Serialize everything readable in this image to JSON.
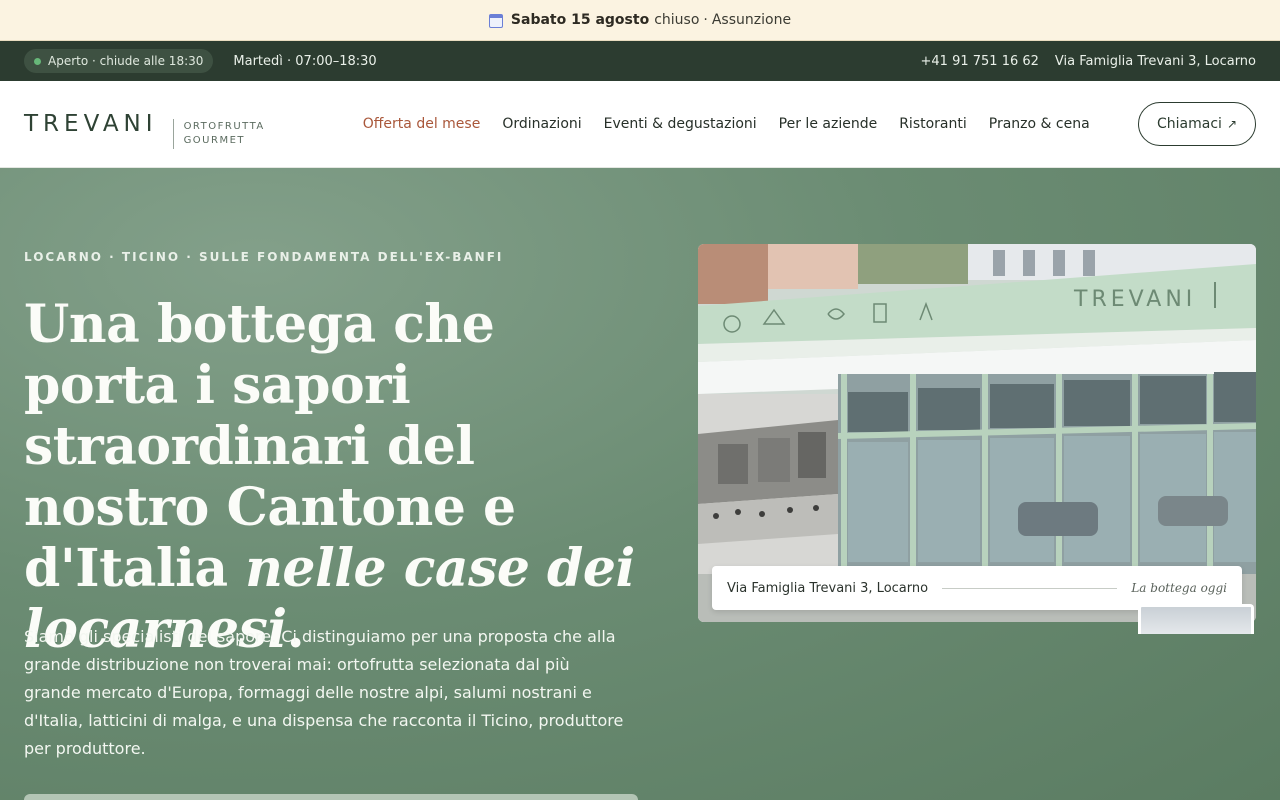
{
  "announcement": {
    "icon": "calendar-icon",
    "date": "Sabato 15 agosto",
    "status": "chiuso",
    "separator": "·",
    "link": "Assunzione"
  },
  "status_bar": {
    "open_badge": "Aperto · chiude alle 18:30",
    "hours": "Martedì · 07:00–18:30",
    "phone": "+41 91 751 16 62",
    "address": "Via Famiglia Trevani 3, Locarno"
  },
  "nav": {
    "logo_word": "TREVANI",
    "logo_sub_1": "ORTOFRUTTA",
    "logo_sub_2": "GOURMET",
    "items": [
      {
        "label": "Offerta del mese",
        "active": true
      },
      {
        "label": "Ordinazioni",
        "active": false
      },
      {
        "label": "Eventi & degustazioni",
        "active": false
      },
      {
        "label": "Per le aziende",
        "active": false
      },
      {
        "label": "Ristoranti",
        "active": false
      },
      {
        "label": "Pranzo & cena",
        "active": false
      }
    ],
    "cta_label": "Chiamaci",
    "cta_icon": "arrow-up-right-icon"
  },
  "hero": {
    "eyebrow": "LOCARNO · TICINO · SULLE FONDAMENTA DELL'EX-BANFI",
    "headline_main": "Una bottega che porta i sapori straordinari del nostro Cantone e d'Italia",
    "headline_italic": "nelle case dei locarnesi",
    "headline_end": ".",
    "lead": "Siamo gli specialisti del sapore. Ci distinguiamo per una proposta che alla grande distribuzione non troverai mai: ortofrutta selezionata dal più grande mercato d'Europa, formaggi delle nostre alpi, salumi nostrani e d'Italia, latticini di malga, e una dispensa che racconta il Ticino, produttore per produttore.",
    "photo_sign": "TREVANI",
    "caption_address": "Via Famiglia Trevani 3, Locarno",
    "caption_tag": "La bottega oggi"
  },
  "colors": {
    "announcement_bg": "#fbf3e1",
    "status_bg": "#2c3c30",
    "hero_bg": "#6b8c73",
    "accent": "#a9573a"
  }
}
